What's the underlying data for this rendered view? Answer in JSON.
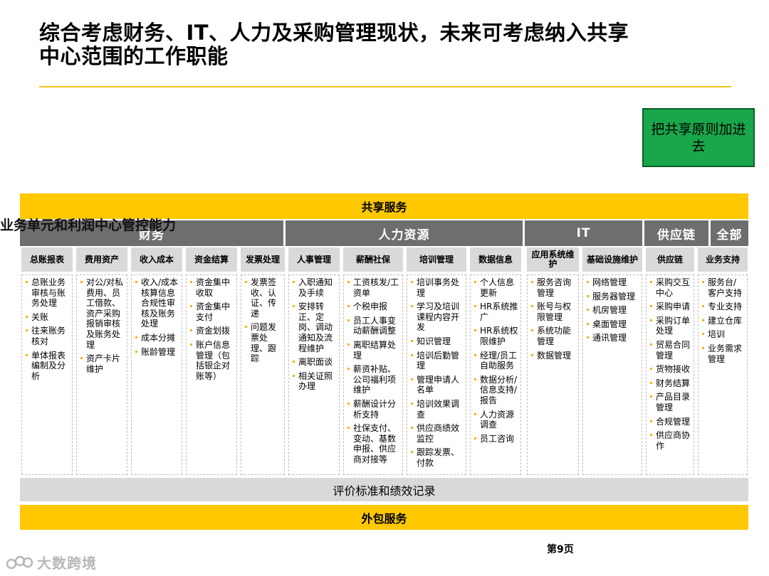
{
  "title_line1": "综合考虑财务、IT、人力及采购管理现状，未来可考虑纳入共享",
  "title_line2": "中心范围的工作职能",
  "note": "把共享原则加进去",
  "shared_banner": "共享服务",
  "overlay_text": "业务单元和利润中心管控能力",
  "groups": [
    "财务",
    "人力资源",
    "IT",
    "供应链",
    "全部"
  ],
  "columns": [
    {
      "header": "总账报表",
      "items": [
        "总账业务审核与账务处理",
        "关账",
        "往来账务核对",
        "单体报表编制及分析"
      ]
    },
    {
      "header": "费用资产",
      "items": [
        "对公/对私费用、员工借款、资产采购报销审核及账务处理",
        "资产卡片维护"
      ]
    },
    {
      "header": "收入成本",
      "items": [
        "收入/成本核算信息合规性审核及账务处理",
        "成本分摊",
        "账龄管理"
      ]
    },
    {
      "header": "资金结算",
      "items": [
        "资金集中收取",
        "资金集中支付",
        "资金划拨",
        "账户信息管理（包括银企对账等）"
      ]
    },
    {
      "header": "发票处理",
      "items": [
        "发票签收、认证、传递",
        "问题发票处理、跟踪"
      ]
    },
    {
      "header": "人事管理",
      "items": [
        "入职通知及手续",
        "安排转正、定岗、调动通知及流程维护",
        "离职面谈",
        "相关证照办理"
      ]
    },
    {
      "header": "薪酬社保",
      "items": [
        "工资核发/工资单",
        "个税申报",
        "员工人事变动薪酬调整",
        "离职结算处理",
        "薪资补贴、公司福利项维护",
        "薪酬设计分析支持",
        "社保支付、变动、基数申报、供应商对接等"
      ]
    },
    {
      "header": "培训管理",
      "items": [
        "培训事务处理",
        "学习及培训课程内容开发",
        "知识管理",
        "培训后勤管理",
        "管理申请人名单",
        "培训效果调查",
        "供应商绩效监控",
        "跟踪发票、付款"
      ]
    },
    {
      "header": "数据信息",
      "items": [
        "个人信息更新",
        "HR系统推广",
        "HR系统权限维护",
        "经理/员工自助服务",
        "数据分析/信息支持/报告",
        "人力资源调查",
        "员工咨询"
      ]
    },
    {
      "header": "应用系统维护",
      "items": [
        "服务咨询管理",
        "账号与权限管理",
        "系统功能管理",
        "数据管理"
      ]
    },
    {
      "header": "基础设施维护",
      "items": [
        "网络管理",
        "服务器管理",
        "机房管理",
        "桌面管理",
        "通讯管理"
      ]
    },
    {
      "header": "供应链",
      "items": [
        "采购交互中心",
        "采购申请",
        "采购订单处理",
        "贸易合同管理",
        "货物接收",
        "财务结算",
        "产品目录管理",
        "合规管理",
        "供应商协作"
      ]
    },
    {
      "header": "业务支持",
      "items": [
        "服务台/客户支持",
        "专业支持",
        "建立仓库",
        "培训",
        "业务需求管理"
      ]
    }
  ],
  "eval_bar": "评价标准和绩效记录",
  "outsource_bar": "外包服务",
  "page_number": "第9页",
  "watermark": "大数跨境",
  "colors": {
    "accent_yellow": "#ffc800",
    "group_gray": "#6e6e6e",
    "header_gray": "#d9d9d9",
    "note_green": "#1aa64a"
  }
}
